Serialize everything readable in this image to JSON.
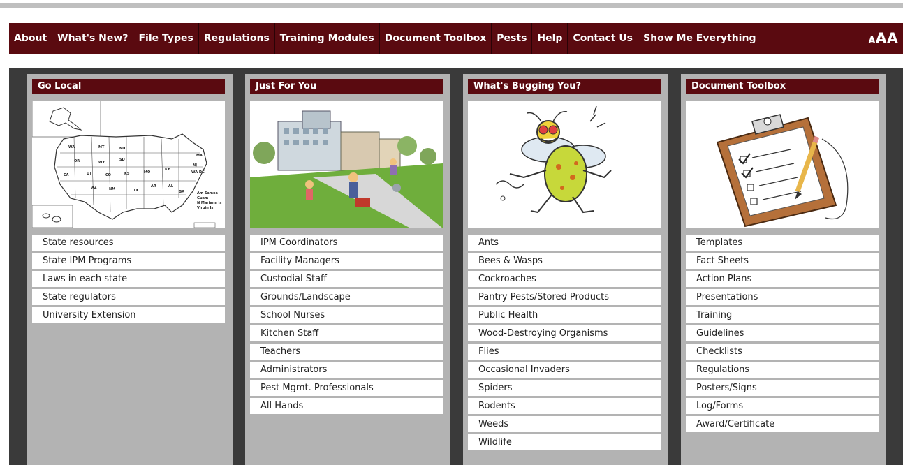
{
  "nav": {
    "items": [
      "About",
      "What's New?",
      "File Types",
      "Regulations",
      "Training Modules",
      "Document Toolbox",
      "Pests",
      "Help",
      "Contact Us",
      "Show Me Everything"
    ],
    "text_size_small": "A",
    "text_size_big": "AA"
  },
  "columns": [
    {
      "title": "Go Local",
      "image": "us-states-map",
      "links": [
        "State resources",
        "State IPM Programs",
        "Laws in each state",
        "State regulators",
        "University Extension"
      ]
    },
    {
      "title": "Just For You",
      "image": "school-grounds-illustration",
      "links": [
        "IPM Coordinators",
        "Facility Managers",
        "Custodial Staff",
        "Grounds/Landscape",
        "School Nurses",
        "Kitchen Staff",
        "Teachers",
        "Administrators",
        "Pest Mgmt. Professionals",
        "All Hands"
      ]
    },
    {
      "title": "What's Bugging You?",
      "image": "cartoon-bug-illustration",
      "links": [
        "Ants",
        "Bees & Wasps",
        "Cockroaches",
        "Pantry Pests/Stored Products",
        "Public Health",
        "Wood-Destroying Organisms",
        "Flies",
        "Occasional Invaders",
        "Spiders",
        "Rodents",
        "Weeds",
        "Wildlife"
      ]
    },
    {
      "title": "Document Toolbox",
      "image": "clipboard-checklist-illustration",
      "links": [
        "Templates",
        "Fact Sheets",
        "Action Plans",
        "Presentations",
        "Training",
        "Guidelines",
        "Checklists",
        "Regulations",
        "Posters/Signs",
        "Log/Forms",
        "Award/Certificate"
      ]
    }
  ],
  "colors": {
    "nav_bg": "#5a0a10",
    "panel_bg": "#3a3a3a",
    "column_bg": "#b3b3b3"
  }
}
